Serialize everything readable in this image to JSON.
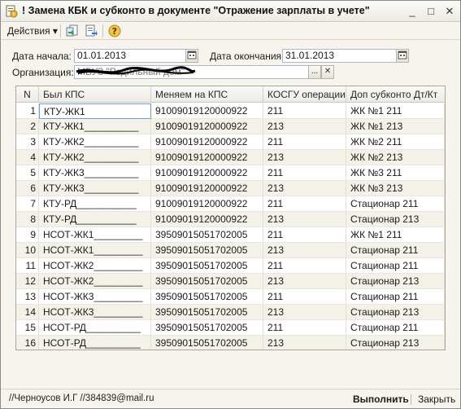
{
  "window": {
    "title": "! Замена КБК и субконто в документе \"Отражение зарплаты в учете\"",
    "controls": {
      "minimize": "_",
      "maximize": "□",
      "close": "✕"
    }
  },
  "toolbar": {
    "actions_label": "Действия ▾",
    "icons": [
      "document-arrow-icon",
      "document-export-icon",
      "help-icon"
    ]
  },
  "form": {
    "date_start_label": "Дата начала:",
    "date_start_value": "01.01.2013",
    "date_end_label": "Дата окончания:",
    "date_end_value": "31.01.2013",
    "org_label": "Организация:",
    "org_value": "МБУЗ \"Родильный дом\"",
    "org_select_btn": "...",
    "org_clear_btn": "✕"
  },
  "table": {
    "columns": [
      "N",
      "Был КПС",
      "Меняем на КПС",
      "КОСГУ операции",
      "Доп субконто Дт/Кт"
    ],
    "rows": [
      [
        "1",
        "КТУ-ЖК1",
        "91009019120000922",
        "211",
        "ЖК №1 211"
      ],
      [
        "2",
        "КТУ-ЖК1__________",
        "91009019120000922",
        "213",
        "ЖК №1 213"
      ],
      [
        "3",
        "КТУ-ЖК2__________",
        "91009019120000922",
        "211",
        "ЖК №2 211"
      ],
      [
        "4",
        "КТУ-ЖК2__________",
        "91009019120000922",
        "213",
        "ЖК №2 213"
      ],
      [
        "5",
        "КТУ-ЖК3__________",
        "91009019120000922",
        "211",
        "ЖК №3 211"
      ],
      [
        "6",
        "КТУ-ЖК3__________",
        "91009019120000922",
        "213",
        "ЖК №3 213"
      ],
      [
        "7",
        "КТУ-РД___________",
        "91009019120000922",
        "211",
        "Стационар 211"
      ],
      [
        "8",
        "КТУ-РД___________",
        "91009019120000922",
        "213",
        "Стационар 213"
      ],
      [
        "9",
        "НСОТ-ЖК1_________",
        "39509015051702005",
        "211",
        "ЖК №1 211"
      ],
      [
        "10",
        "НСОТ-ЖК1_________",
        "39509015051702005",
        "213",
        "Стационар 211"
      ],
      [
        "11",
        "НСОТ-ЖК2_________",
        "39509015051702005",
        "211",
        "Стационар 211"
      ],
      [
        "12",
        "НСОТ-ЖК2_________",
        "39509015051702005",
        "213",
        "Стационар 213"
      ],
      [
        "13",
        "НСОТ-ЖК3_________",
        "39509015051702005",
        "211",
        "Стационар 211"
      ],
      [
        "14",
        "НСОТ-ЖК3_________",
        "39509015051702005",
        "213",
        "Стационар 213"
      ],
      [
        "15",
        "НСОТ-РД__________",
        "39509015051702005",
        "211",
        "Стационар 211"
      ],
      [
        "16",
        "НСОТ-РД__________",
        "39509015051702005",
        "213",
        "Стационар 213"
      ]
    ]
  },
  "status": {
    "user_text": "//Черноусов И.Г //384839@mail.ru",
    "run_label": "Выполнить",
    "close_label": "Закрыть"
  },
  "colors": {
    "window_bg": "#f6f4ec",
    "accent": "#6f9ad6",
    "row_alt": "#f4f2e8"
  }
}
